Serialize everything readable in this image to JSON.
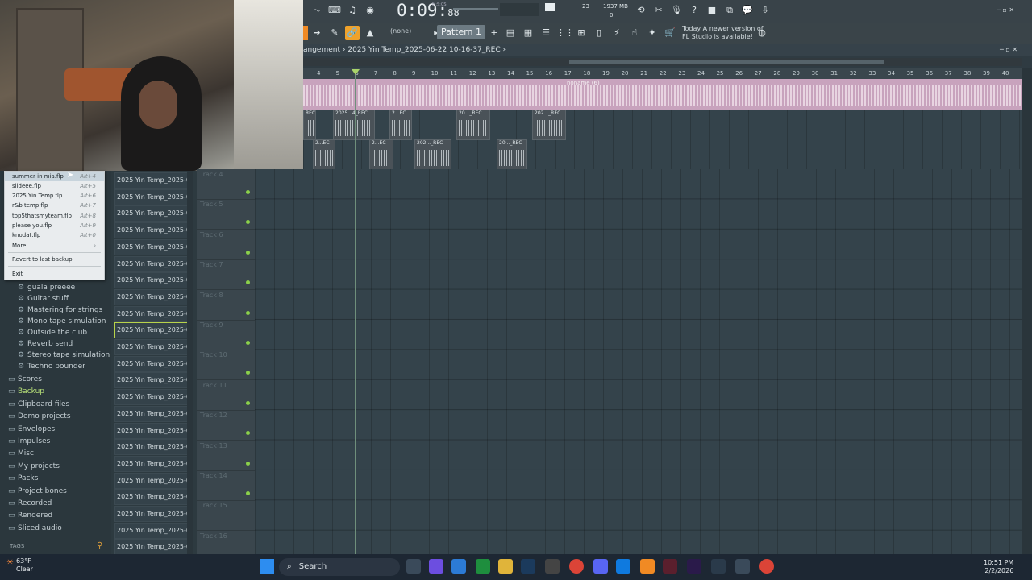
{
  "transport": {
    "time_main": "0:09:",
    "time_sub": "88",
    "time_unit": "M:S:CS",
    "cpu": "23",
    "memory": "1937 MB",
    "mem_sub": "0"
  },
  "toolbar": {
    "pattern_label": "Pattern 1",
    "none_label": "(none)",
    "news_line1": "Today  A newer version of",
    "news_line2": "FL Studio is available!"
  },
  "arrangement": {
    "crumb1": "angement",
    "crumb2": "2025 Yin Temp_2025-06-22 10-16-37_REC",
    "arrow": "›"
  },
  "ruler": [
    "4",
    "5",
    "6",
    "7",
    "8",
    "9",
    "10",
    "11",
    "12",
    "13",
    "14",
    "15",
    "16",
    "17",
    "18",
    "19",
    "20",
    "21",
    "22",
    "23",
    "24",
    "25",
    "26",
    "27",
    "28",
    "29",
    "30",
    "31",
    "32",
    "33",
    "34",
    "35",
    "36",
    "37",
    "38",
    "39",
    "40"
  ],
  "clips": {
    "noname": "noname (6)",
    "c1": "REC",
    "c2": "2025...4_REC",
    "c3": "2...EC",
    "c4": "20..._REC",
    "c5": "202..._REC",
    "c6": "2...EC",
    "c7": "2...EC",
    "c8": "202..._REC",
    "c9": "20..._REC"
  },
  "tracks": [
    "Track 4",
    "Track 5",
    "Track 6",
    "Track 7",
    "Track 8",
    "Track 9",
    "Track 10",
    "Track 11",
    "Track 12",
    "Track 13",
    "Track 14",
    "Track 15",
    "Track 16"
  ],
  "files": [
    "2025 Yin Temp_2025-06-...",
    "2025 Yin Temp_2025-06-...",
    "2025 Yin Temp_2025-06-...",
    "2025 Yin Temp_2025-06-...",
    "2025 Yin Temp_2025-06-...",
    "2025 Yin Temp_2025-06-...",
    "2025 Yin Temp_2025-06-...",
    "2025 Yin Temp_2025-06-...",
    "2025 Yin Temp_2025-06-...",
    "2025 Yin Temp_2025-06-...",
    "2025 Yin Temp_2025-06-...",
    "2025 Yin Temp_2025-06-...",
    "2025 Yin Temp_2025-06-...",
    "2025 Yin Temp_2025-06-...",
    "2025 Yin Temp_2025-06-...",
    "2025 Yin Temp_2025-06-...",
    "2025 Yin Temp_2025-06-...",
    "2025 Yin Temp_2025-06-...",
    "2025 Yin Temp_2025-06-...",
    "2025 Yin Temp_2025-06-...",
    "2025 Yin Temp_2025-06-...",
    "2025 Yin Temp_2025-06-...",
    "2025 Yin Temp_2025-06-..."
  ],
  "menu": [
    {
      "label": "summer in mia.flp",
      "shortcut": "Alt+4"
    },
    {
      "label": "slideee.flp",
      "shortcut": "Alt+5"
    },
    {
      "label": "2025 Yin Temp.flp",
      "shortcut": "Alt+6"
    },
    {
      "label": "r&b temp.flp",
      "shortcut": "Alt+7"
    },
    {
      "label": "top5thatsmyteam.flp",
      "shortcut": "Alt+8"
    },
    {
      "label": "please you.flp",
      "shortcut": "Alt+9"
    },
    {
      "label": "knodat.flp",
      "shortcut": "Alt+0"
    },
    {
      "label": "More",
      "shortcut": "›"
    },
    {
      "label": "Revert to last backup",
      "shortcut": ""
    },
    {
      "label": "Exit",
      "shortcut": ""
    }
  ],
  "browser": {
    "presets": [
      "guala preeee",
      "Guitar stuff",
      "Mastering for strings",
      "Mono tape simulation",
      "Outside the club",
      "Reverb send",
      "Stereo tape simulation",
      "Techno pounder"
    ],
    "folders": [
      "Scores",
      "Backup",
      "Clipboard files",
      "Demo projects",
      "Envelopes",
      "Impulses",
      "Misc",
      "My projects",
      "Packs",
      "Project bones",
      "Recorded",
      "Rendered",
      "Sliced audio"
    ],
    "tags_label": "TAGS"
  },
  "taskbar": {
    "temp": "63°F",
    "weather": "Clear",
    "search": "Search",
    "time": "10:51 PM",
    "date": "2/2/2026"
  },
  "colors": {
    "accent_green": "#b8d34a",
    "audio_clip": "#c8a3bd",
    "grid_bg": "#34434b"
  }
}
